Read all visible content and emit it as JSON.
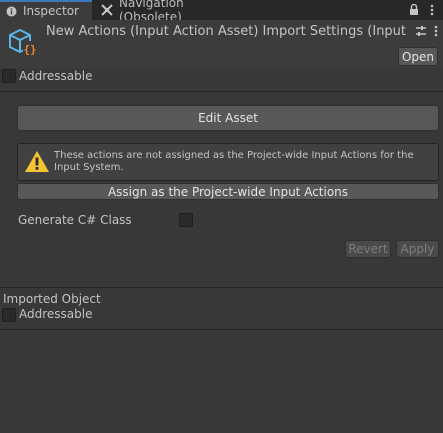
{
  "tabs": [
    {
      "label": "Inspector",
      "icon": "info-icon"
    },
    {
      "label": "Navigation (Obsolete)",
      "icon": "navigation-icon"
    }
  ],
  "header": {
    "title": "New Actions (Input Action Asset) Import Settings (Input Action Asset)",
    "open_label": "Open",
    "asset_icon": "input-action-asset-icon"
  },
  "addressable_top": {
    "label": "Addressable",
    "checked": false
  },
  "edit_asset_label": "Edit Asset",
  "help": {
    "icon": "warning-icon",
    "message": "These actions are not assigned as the Project-wide Input Actions for the Input System."
  },
  "assign_label": "Assign as the Project-wide Input Actions",
  "generate_csharp": {
    "label": "Generate C# Class",
    "checked": false
  },
  "revert_label": "Revert",
  "apply_label": "Apply",
  "imported_object": {
    "title": "Imported Object",
    "addressable_label": "Addressable",
    "checked": false
  },
  "colors": {
    "background": "#383838",
    "tab_bar": "#282828",
    "accent": "#3a79bb",
    "asset_icon_blue": "#59b7e6",
    "asset_icon_orange": "#f08a24",
    "warning_yellow": "#f6c333"
  }
}
